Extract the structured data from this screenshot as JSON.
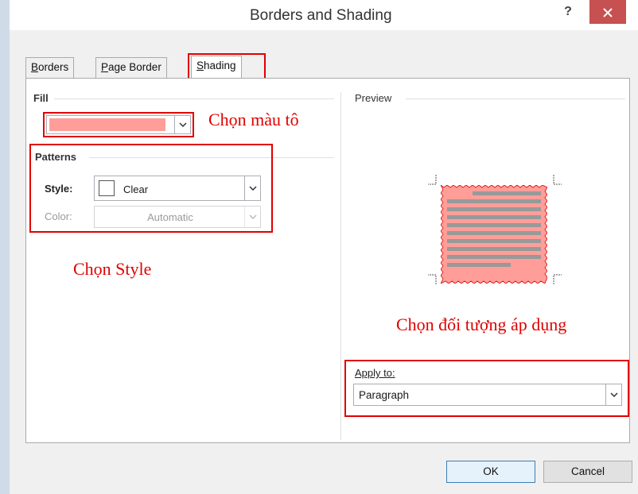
{
  "window": {
    "title": "Borders and Shading",
    "help_label": "?",
    "close_label": "close"
  },
  "tabs": [
    {
      "label": "Borders",
      "accel": "B",
      "rest": "orders"
    },
    {
      "label": "Page Border",
      "accel": "P",
      "rest": "age Border"
    },
    {
      "label": "Shading",
      "accel": "S",
      "rest": "hading"
    }
  ],
  "fill": {
    "group_label": "Fill",
    "color": "#ff9e99"
  },
  "patterns": {
    "group_label": "Patterns",
    "style_label": "Style:",
    "style_value": "Clear",
    "color_label": "Color:",
    "color_value": "Automatic"
  },
  "preview": {
    "group_label": "Preview",
    "shading_color": "#ff9e99",
    "line_color": "#999999"
  },
  "apply_to": {
    "label": "Apply to:",
    "value": "Paragraph"
  },
  "annotations": {
    "fill": "Chọn màu tô",
    "style": "Chọn Style",
    "apply": "Chọn đối tượng áp dụng"
  },
  "buttons": {
    "ok": "OK",
    "cancel": "Cancel"
  },
  "colors": {
    "highlight": "#e00000",
    "close_bg": "#c75050"
  }
}
